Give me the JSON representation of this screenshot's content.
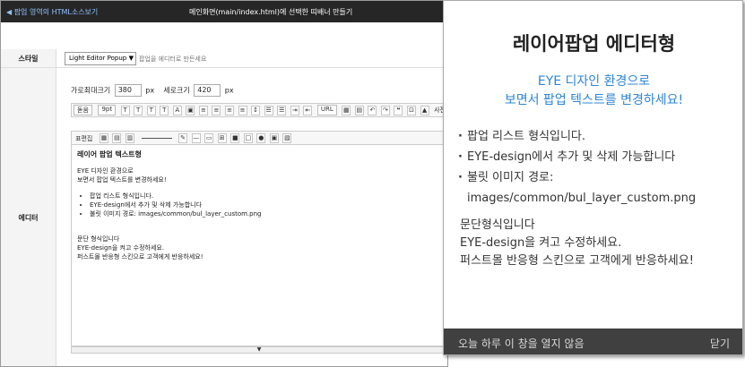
{
  "topbar": {
    "back_label": "◀ 팝업 영역의 HTML소스보기",
    "title": "메인화면(main/index.html)에 선택한 띠배너 만들기"
  },
  "style_row": {
    "label": "스타일",
    "select_value": "Light Editor Popup",
    "help": "팝업을 에디터로 만든세요"
  },
  "editor_row": {
    "label": "에디터",
    "width_label": "가로최대크기",
    "width_value": "380",
    "height_label": "세로크기",
    "height_value": "420",
    "unit": "px"
  },
  "toolbar": {
    "font_select": "돋움",
    "size_select": "9pt",
    "url_label": "URL",
    "photo_label": "사진(이터"
  },
  "toolbar2": {
    "table_label": "표편집"
  },
  "content": {
    "title": "레이어 팝업 텍스트형",
    "line1": "EYE 디자인 환경으로",
    "line2": "보면서 팝업 텍스트를 변경하세요!",
    "bullets": [
      "팝업 리스트 형식입니다.",
      "EYE-design에서 추가 및 삭제 가능합니다",
      "불릿 이미지 경로: images/common/bul_layer_custom.png"
    ],
    "para": [
      "문단 형식입니다",
      "EYE-design을 켜고 수정하세요.",
      "퍼스트몰 반응형 스킨으로 고객에게 반응하세요!"
    ]
  },
  "popup": {
    "title": "레이어팝업 에디터형",
    "sub1": "EYE 디자인 환경으로",
    "sub2": "보면서 팝업 텍스트를 변경하세요!",
    "bullets": {
      "b1": "팝업 리스트 형식입니다.",
      "b2": "EYE-design에서 추가 및 삭제 가능합니다",
      "b3_label": "불릿 이미지 경로:",
      "b3_path": "images/common/bul_layer_custom.png"
    },
    "para": [
      "문단형식입니다",
      "EYE-design을 켜고 수정하세요.",
      "퍼스트몰 반응형 스킨으로 고객에게 반응하세요!"
    ],
    "footer_dont_show": "오늘 하루 이 창을 열지 않음",
    "footer_close": "닫기"
  },
  "colors": {
    "topbar_bg": "#262626",
    "accent_blue": "#2d85d6",
    "footer_bg": "#404040"
  }
}
